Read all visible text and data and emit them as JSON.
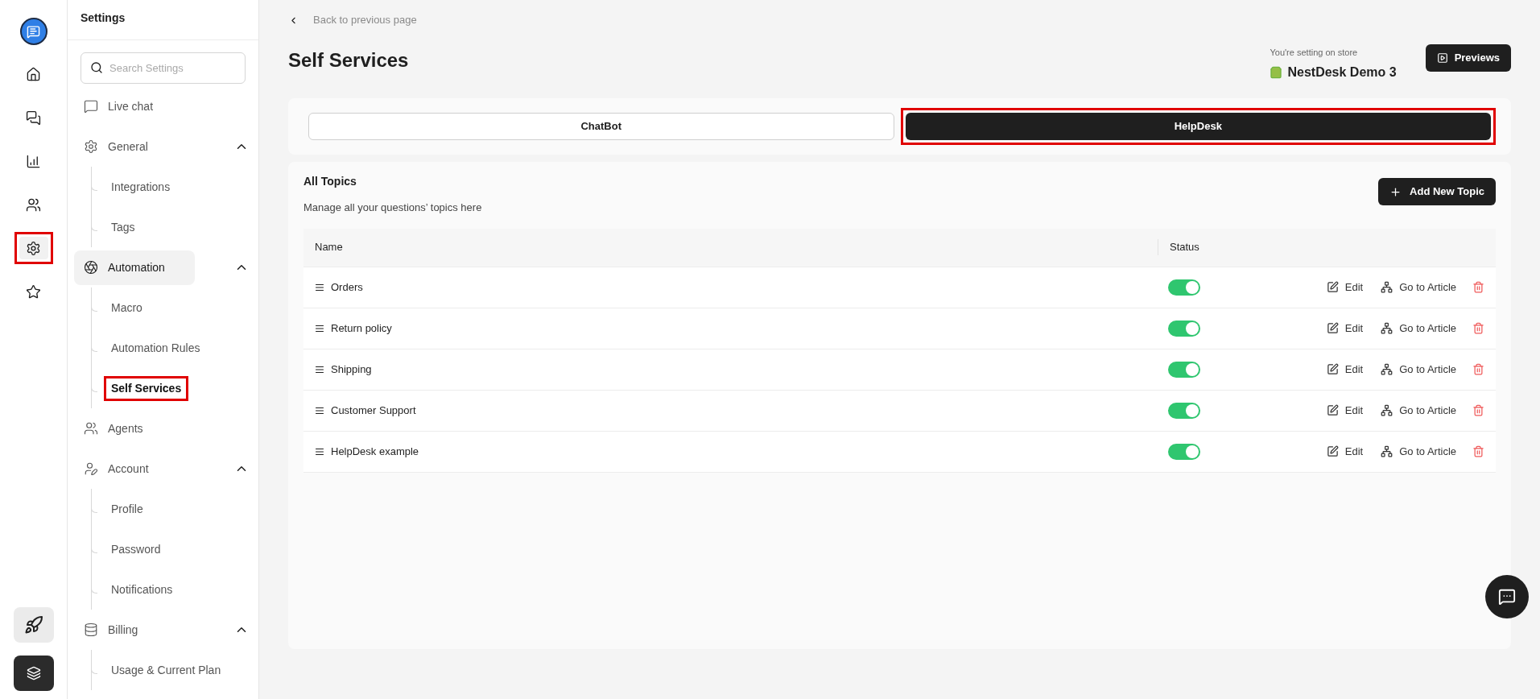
{
  "rail": {
    "items": [
      {
        "kind": "home",
        "selected": false,
        "highlighted": false
      },
      {
        "kind": "chats",
        "selected": false,
        "highlighted": false
      },
      {
        "kind": "reports",
        "selected": false,
        "highlighted": false
      },
      {
        "kind": "contacts",
        "selected": false,
        "highlighted": false
      },
      {
        "kind": "settings",
        "selected": true,
        "highlighted": true
      },
      {
        "kind": "star",
        "selected": false,
        "highlighted": false
      }
    ]
  },
  "sidebar": {
    "title": "Settings",
    "search": {
      "placeholder": "Search Settings"
    },
    "groups": [
      {
        "kind": "chat",
        "label": "Live chat",
        "selected": false
      },
      {
        "kind": "gear",
        "label": "General",
        "selected": false,
        "expanded": true,
        "children": [
          {
            "label": "Integrations",
            "selected": false,
            "highlighted": false
          },
          {
            "label": "Tags",
            "selected": false,
            "highlighted": false
          }
        ]
      },
      {
        "kind": "aperture",
        "label": "Automation",
        "selected": true,
        "expanded": true,
        "children": [
          {
            "label": "Macro",
            "selected": false,
            "highlighted": false
          },
          {
            "label": "Automation Rules",
            "selected": false,
            "highlighted": false
          },
          {
            "label": "Self Services",
            "selected": true,
            "highlighted": true
          }
        ]
      },
      {
        "kind": "users",
        "label": "Agents",
        "selected": false
      },
      {
        "kind": "user-pen",
        "label": "Account",
        "selected": false,
        "expanded": true,
        "children": [
          {
            "label": "Profile",
            "selected": false,
            "highlighted": false
          },
          {
            "label": "Password",
            "selected": false,
            "highlighted": false
          },
          {
            "label": "Notifications",
            "selected": false,
            "highlighted": false
          }
        ]
      },
      {
        "kind": "database",
        "label": "Billing",
        "selected": false,
        "expanded": true,
        "children": [
          {
            "label": "Usage & Current Plan",
            "selected": false,
            "highlighted": false
          }
        ]
      }
    ]
  },
  "header": {
    "back": "Back to previous page",
    "title": "Self Services",
    "store_label": "You're setting on store",
    "store_name": "NestDesk Demo 3",
    "previews": "Previews"
  },
  "tabs": [
    {
      "label": "ChatBot",
      "selected": false,
      "highlighted": false
    },
    {
      "label": "HelpDesk",
      "selected": true,
      "highlighted": true
    }
  ],
  "topics": {
    "title": "All Topics",
    "subtitle": "Manage all your questions’ topics here",
    "add_button": "Add New Topic",
    "columns": [
      "Name",
      "Status"
    ],
    "rows": [
      {
        "name": "Orders",
        "on": true,
        "edit": "Edit",
        "article": "Go to Article"
      },
      {
        "name": "Return policy",
        "on": true,
        "edit": "Edit",
        "article": "Go to Article"
      },
      {
        "name": "Shipping",
        "on": true,
        "edit": "Edit",
        "article": "Go to Article"
      },
      {
        "name": "Customer Support",
        "on": true,
        "edit": "Edit",
        "article": "Go to Article"
      },
      {
        "name": "HelpDesk example",
        "on": true,
        "edit": "Edit",
        "article": "Go to Article"
      }
    ]
  }
}
